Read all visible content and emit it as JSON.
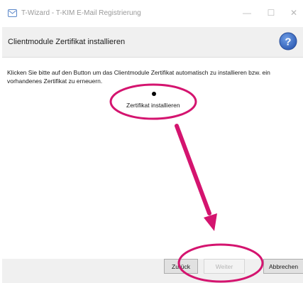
{
  "window": {
    "title": "T-Wizard - T-KIM E-Mail Registrierung",
    "icon": "mail-app-icon",
    "controls": {
      "minimize": "—",
      "maximize": "☐",
      "close": "✕"
    }
  },
  "header": {
    "title": "Clientmodule Zertifikat installieren",
    "help_icon_glyph": "?",
    "help_color": "#3a6fc8"
  },
  "content": {
    "instruction": "Klicken Sie bitte auf den Button um das Clientmodule Zertifikat automatisch zu installieren bzw. ein vorhandenes Zertifikat zu erneuern.",
    "install_label": "Zertifikat installieren"
  },
  "footer": {
    "back_label": "Zurück",
    "next_label": "Weiter",
    "cancel_label": "Abbrechen"
  },
  "annotation": {
    "color": "#d4146f"
  }
}
